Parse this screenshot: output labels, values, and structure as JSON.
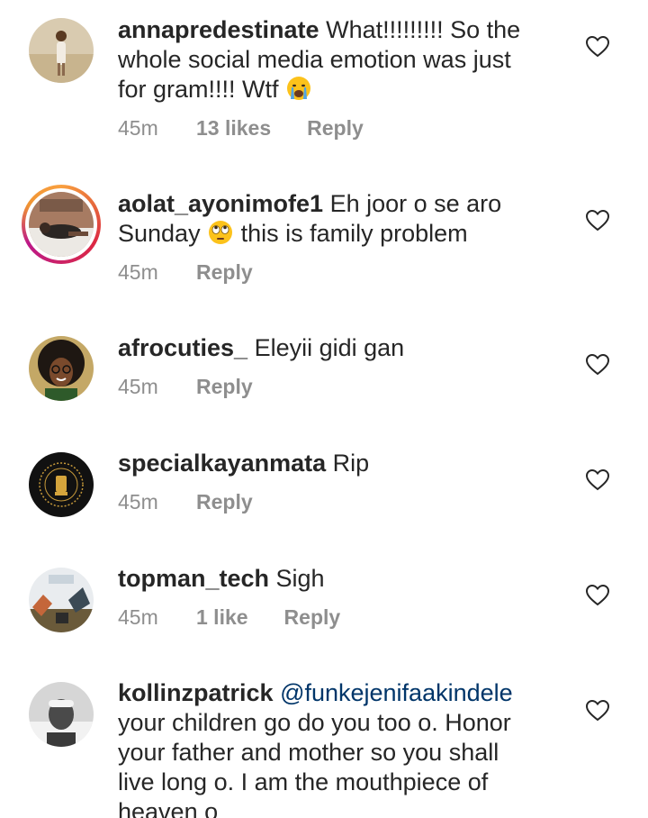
{
  "comments": [
    {
      "username": "annapredestinate",
      "text": " What!!!!!!!!! So the whole social media emotion was just for gram!!!! Wtf",
      "emoji_after": "crying-face",
      "time": "45m",
      "likes": "13 likes",
      "reply": "Reply"
    },
    {
      "username": "aolat_ayonimofe1",
      "text_before": " Eh joor o se aro Sunday ",
      "emoji_mid": "eye-roll-face",
      "text_after": " this is family problem",
      "time": "45m",
      "reply": "Reply"
    },
    {
      "username": "afrocuties_",
      "text": " Eleyii gidi gan",
      "time": "45m",
      "reply": "Reply"
    },
    {
      "username": "specialkayanmata",
      "text": " Rip",
      "time": "45m",
      "reply": "Reply"
    },
    {
      "username": "topman_tech",
      "text": " Sigh",
      "time": "45m",
      "likes": "1 like",
      "reply": "Reply"
    },
    {
      "username": "kollinzpatrick",
      "mention": "@funkejenifaakindele",
      "text": " your children go do you too o. Honor your father and mother so you shall live long o. I am the mouthpiece of heaven o"
    }
  ],
  "colors": {
    "text": "#262626",
    "meta": "#8e8e8e",
    "mention": "#003569"
  }
}
